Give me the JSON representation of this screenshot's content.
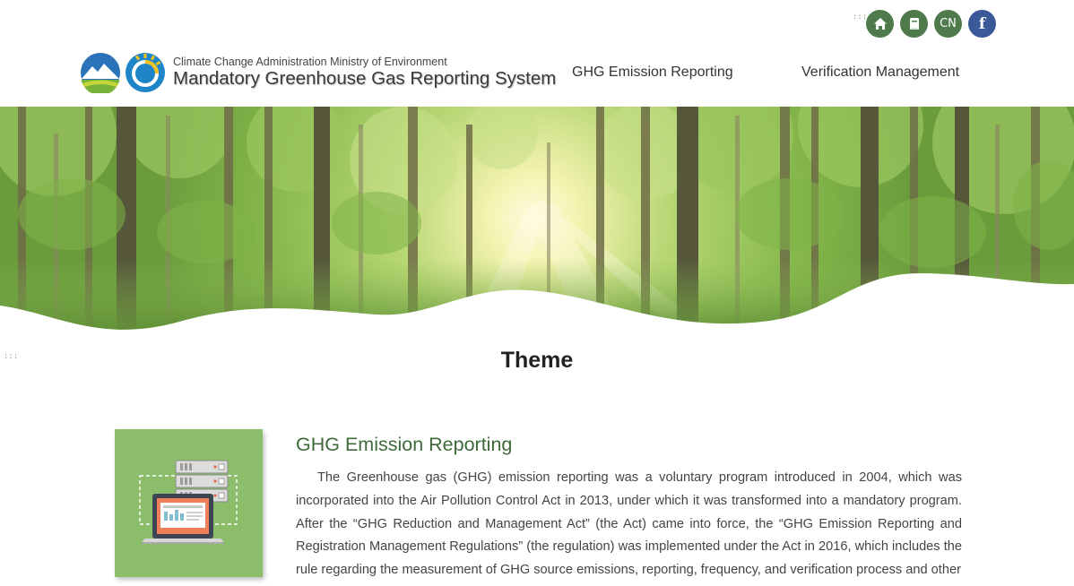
{
  "header": {
    "agency": "Climate Change Administration Ministry of Environment",
    "system_name": "Mandatory Greenhouse Gas Reporting System"
  },
  "accesskey": ":::",
  "utility": {
    "home_icon": "home-icon",
    "book_icon": "book-icon",
    "language": "CN",
    "facebook": "f"
  },
  "nav": {
    "items": [
      "GHG Emission Reporting",
      "Verification Management"
    ]
  },
  "banner": {
    "image": "forest-sunlight"
  },
  "theme": {
    "title": "Theme",
    "section": {
      "title": "GHG Emission Reporting",
      "body": "The Greenhouse gas (GHG) emission reporting was a voluntary program introduced in 2004, which was incorporated into the Air Pollution Control Act in 2013, under which it was transformed into a mandatory program. After the “GHG Reduction and Management Act” (the Act) came into force, the “GHG Emission Reporting and Registration Management Regulations” (the regulation) was implemented under the Act in 2016, which includes the rule regarding the measurement of GHG source emissions, reporting, frequency, and verification process and other"
    }
  },
  "colors": {
    "icon_green": "#4f7a4b",
    "facebook_blue": "#3b5998",
    "section_title_green": "#3e6a3a",
    "card_green": "#8bbd6a"
  }
}
